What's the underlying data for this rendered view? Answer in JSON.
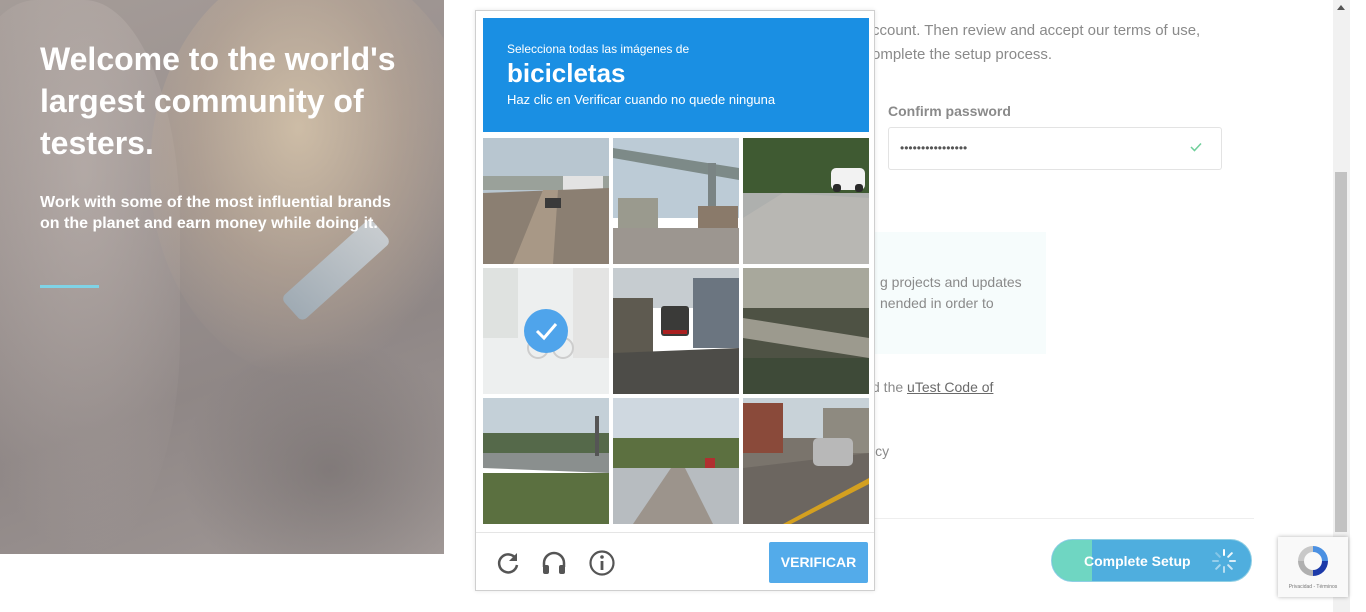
{
  "hero": {
    "title": "Welcome to the world's largest community of testers.",
    "subtitle": "Work with some of the most influential brands on the planet and earn money while doing it."
  },
  "form": {
    "intro_line1": "ccount. Then review and accept our terms of use,",
    "intro_line2": "omplete the setup process.",
    "confirm_password_label": "Confirm password",
    "confirm_password_value": "••••••••••••••••",
    "info_line1": "g projects and updates",
    "info_line2": "nended in order to",
    "code_prefix": "d the ",
    "code_link": "uTest Code of",
    "policy_fragment": "icy",
    "complete_button": "Complete Setup",
    "progress_fraction": 0.2
  },
  "captcha": {
    "instruction_small": "Selecciona todas las imágenes de",
    "target": "bicicletas",
    "hint": "Haz clic en Verificar cuando no quede ninguna",
    "verify_label": "VERIFICAR",
    "icons": [
      "reload-icon",
      "audio-icon",
      "info-icon"
    ],
    "tiles": [
      {
        "scene": "highway with trucks",
        "selected": false
      },
      {
        "scene": "overpass sign gantry",
        "selected": false
      },
      {
        "scene": "street with white car",
        "selected": false
      },
      {
        "scene": "faded street with bicycle",
        "selected": true
      },
      {
        "scene": "road with trucks and car",
        "selected": false
      },
      {
        "scene": "bridge over water",
        "selected": false
      },
      {
        "scene": "overpass and grass",
        "selected": false
      },
      {
        "scene": "suburban road",
        "selected": false
      },
      {
        "scene": "street with grey car",
        "selected": false
      }
    ]
  },
  "recaptcha_badge": {
    "terms": "Privacidad - Términos"
  },
  "colors": {
    "captcha_blue": "#1a8fe3",
    "button_blue": "#4faede",
    "button_progress": "#6fd6c2",
    "accent_line": "#7fd3e6"
  }
}
